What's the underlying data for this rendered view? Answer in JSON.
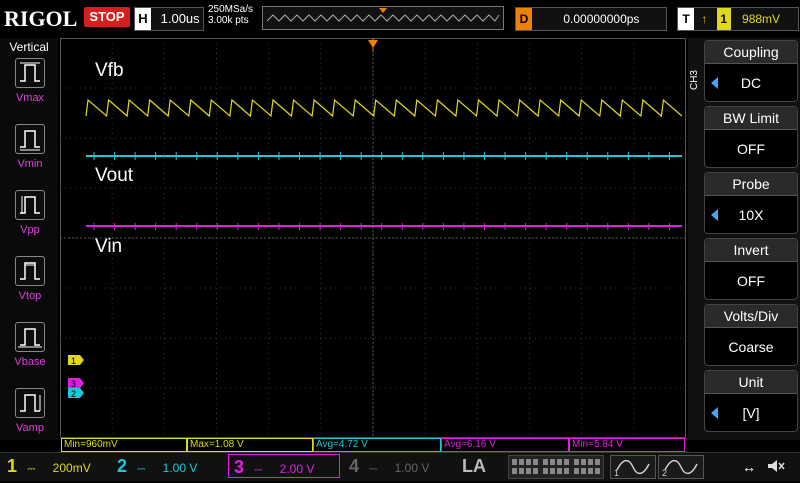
{
  "topbar": {
    "logo": "RIGOL",
    "run_state": "STOP",
    "horiz_key": "H",
    "timebase": "1.00us",
    "sample_rate": "250MSa/s",
    "mem_depth": "3.00k pts",
    "delay_key": "D",
    "delay": "0.00000000ps",
    "trig_key": "T",
    "trig_channel": "1",
    "trig_level": "988mV"
  },
  "left_panel": {
    "title": "Vertical",
    "items": [
      {
        "label": "Vmax",
        "icon": "vmax-icon"
      },
      {
        "label": "Vmin",
        "icon": "vmin-icon"
      },
      {
        "label": "Vpp",
        "icon": "vpp-icon"
      },
      {
        "label": "Vtop",
        "icon": "vtop-icon"
      },
      {
        "label": "Vbase",
        "icon": "vbase-icon"
      },
      {
        "label": "Vamp",
        "icon": "vamp-icon"
      }
    ]
  },
  "right_panel": {
    "channel_tag": "CH3",
    "items": [
      {
        "title": "Coupling",
        "value": "DC",
        "arrow": true
      },
      {
        "title": "BW Limit",
        "value": "OFF",
        "arrow": false
      },
      {
        "title": "Probe",
        "value": "10X",
        "arrow": true
      },
      {
        "title": "Invert",
        "value": "OFF",
        "arrow": false
      },
      {
        "title": "Volts/Div",
        "value": "Coarse",
        "arrow": false
      },
      {
        "title": "Unit",
        "value": "[V]",
        "arrow": true
      }
    ]
  },
  "traces": {
    "ch1": {
      "label": "Vfb",
      "color": "#e0d81c",
      "marker": "1"
    },
    "ch2": {
      "label": "Vout",
      "color": "#1fc6d6",
      "marker": "2"
    },
    "ch3": {
      "label": "Vin",
      "color": "#e020e0",
      "marker": "3"
    }
  },
  "measurements": [
    {
      "text": "Min=960mV",
      "color": "#e0d81c"
    },
    {
      "text": "Max=1.08 V",
      "color": "#e0d81c"
    },
    {
      "text": "Avg=4.72 V",
      "color": "#1fc6d6"
    },
    {
      "text": "Avg=6.16 V",
      "color": "#e020e0"
    },
    {
      "text": "Min=5.84 V",
      "color": "#e020e0"
    }
  ],
  "bottombar": {
    "channels": [
      {
        "num": "1",
        "scale": "200mV",
        "color": "#e0d81c"
      },
      {
        "num": "2",
        "scale": "1.00 V",
        "color": "#1fc6d6"
      },
      {
        "num": "3",
        "scale": "2.00 V",
        "color": "#e020e0"
      },
      {
        "num": "4",
        "scale": "1.00 V",
        "color": "#555555"
      }
    ],
    "la_label": "LA"
  }
}
